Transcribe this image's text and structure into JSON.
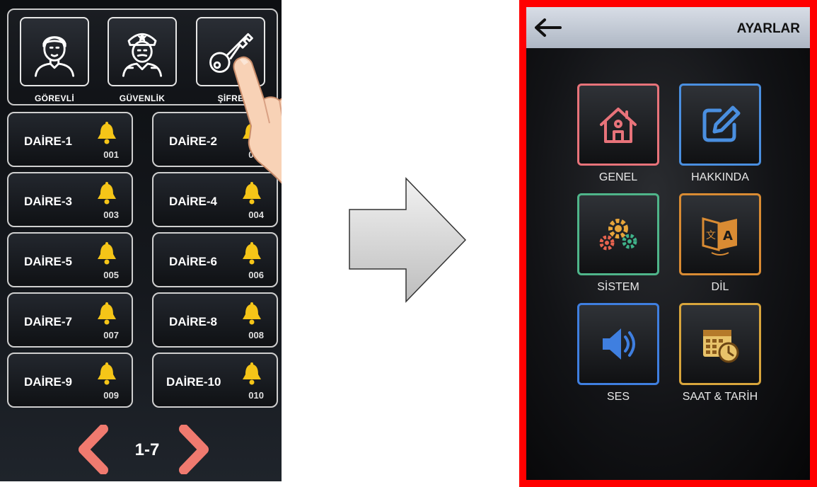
{
  "left_screen": {
    "roles": [
      {
        "label": "GÖREVLİ",
        "icon": "man-icon"
      },
      {
        "label": "GÜVENLİK",
        "icon": "security-guard-icon"
      },
      {
        "label": "ŞİFRE",
        "icon": "key-icon"
      }
    ],
    "apartments": [
      {
        "name": "DAİRE-1",
        "code": "001"
      },
      {
        "name": "DAİRE-2",
        "code": "002"
      },
      {
        "name": "DAİRE-3",
        "code": "003"
      },
      {
        "name": "DAİRE-4",
        "code": "004"
      },
      {
        "name": "DAİRE-5",
        "code": "005"
      },
      {
        "name": "DAİRE-6",
        "code": "006"
      },
      {
        "name": "DAİRE-7",
        "code": "007"
      },
      {
        "name": "DAİRE-8",
        "code": "008"
      },
      {
        "name": "DAİRE-9",
        "code": "009"
      },
      {
        "name": "DAİRE-10",
        "code": "010"
      }
    ],
    "pager": {
      "label": "1-7",
      "prev_icon": "chevron-left-icon",
      "next_icon": "chevron-right-icon"
    }
  },
  "right_screen": {
    "title": "AYARLAR",
    "back_icon": "back-arrow-icon",
    "items": [
      {
        "label": "GENEL",
        "icon": "home-icon",
        "color": "#e8737a"
      },
      {
        "label": "HAKKINDA",
        "icon": "edit-icon",
        "color": "#4a8fe0"
      },
      {
        "label": "SİSTEM",
        "icon": "gears-icon",
        "color": "#4fb58a"
      },
      {
        "label": "DİL",
        "icon": "language-icon",
        "color": "#d98b33"
      },
      {
        "label": "SES",
        "icon": "speaker-icon",
        "color": "#3f7fe0"
      },
      {
        "label": "SAAT & TARİH",
        "icon": "calendar-clock-icon",
        "color": "#d8a53c"
      }
    ],
    "frame_color": "#ff0000"
  },
  "colors": {
    "bell": "#f5c518",
    "pager_arrow": "#f07a6f"
  }
}
